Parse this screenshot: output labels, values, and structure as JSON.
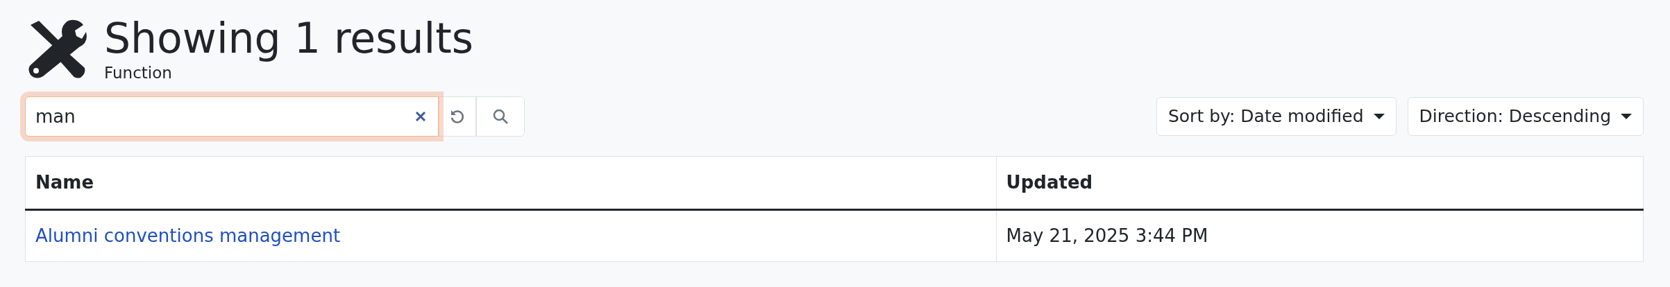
{
  "header": {
    "title": "Showing 1 results",
    "subtitle": "Function"
  },
  "search": {
    "value": "man",
    "focused": true
  },
  "sort": [
    {
      "label": "Sort by: Date modified"
    },
    {
      "label": "Direction: Descending"
    }
  ],
  "table": {
    "columns": [
      "Name",
      "Updated"
    ],
    "rows": [
      {
        "name": "Alumni conventions management",
        "updated": "May 21, 2025 3:44 PM"
      }
    ]
  }
}
